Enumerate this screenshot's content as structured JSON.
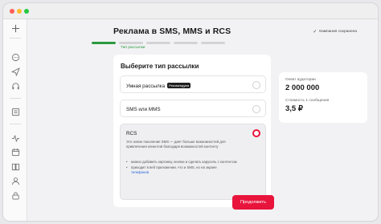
{
  "window": {
    "traffic_lights": [
      "#ff5f57",
      "#febc2e",
      "#28c840"
    ]
  },
  "sidebar": {
    "icons": [
      "plus-icon",
      "chat-icon",
      "send-icon",
      "headphones-icon",
      "list-icon",
      "activity-icon",
      "calendar-icon",
      "book-icon",
      "user-icon",
      "lock-icon"
    ]
  },
  "header": {
    "title": "Реклама в SMS, MMS и RCS",
    "save_status": "Кампания сохранена"
  },
  "progress": {
    "total_steps": 5,
    "current_step": 1,
    "current_label": "Тип рассылки"
  },
  "form": {
    "title": "Выберите тип рассылки",
    "options": [
      {
        "label": "Умная рассылка",
        "badge": "Рекомендуем",
        "selected": false
      },
      {
        "label": "SMS или MMS",
        "selected": false
      },
      {
        "label": "RCS",
        "selected": true,
        "description": "Это новое поколение SMS — даёт больше возможностей для привлечения клиентов благодаря возвожностей контенту",
        "bullets": [
          "можно добавить картинку, кнопки и сделать карусель с контентом",
          "приходит в веб приложении, что и SMS, но на экране"
        ],
        "link": "телефонов"
      }
    ]
  },
  "stats": {
    "audience_label": "Охват аудитории",
    "audience_value": "2 000 000",
    "cost_label": "Стоимость 1 сообщения",
    "cost_value": "3,5 ₽"
  },
  "actions": {
    "continue_label": "Продолжить"
  },
  "colors": {
    "accent": "#e8143c",
    "progress": "#2c9a3f",
    "link": "#1f5fd6"
  }
}
